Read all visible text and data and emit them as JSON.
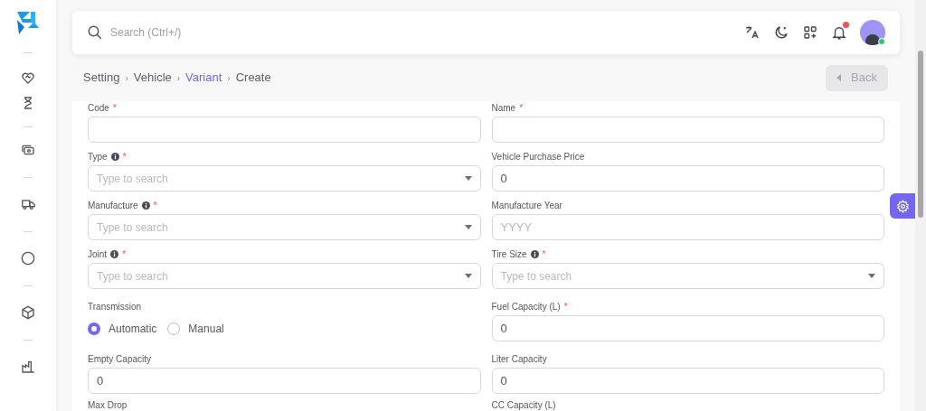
{
  "search": {
    "placeholder": "Search (Ctrl+/)"
  },
  "header": {
    "notification_unread": true,
    "user_online": true
  },
  "breadcrumb": [
    {
      "label": "Setting",
      "selected": false
    },
    {
      "separator": "›",
      "label": "Vehicle",
      "selected": false
    },
    {
      "separator": "›",
      "label": "Variant",
      "selected": true
    },
    {
      "separator": "›",
      "label": "Create",
      "selected": false
    }
  ],
  "back_button": {
    "label": "Back",
    "disabled": true
  },
  "fields": [
    {
      "kind": "text",
      "label": "Code",
      "required_mark": "*",
      "info": false
    },
    {
      "kind": "text",
      "label": "Name",
      "required_mark": "*",
      "info": false
    },
    {
      "kind": "select",
      "label": "Type",
      "required_mark": "*",
      "info": true,
      "placeholder": "Type to search"
    },
    {
      "kind": "text",
      "label": "Vehicle Purchase Price",
      "info": false,
      "value": "0"
    },
    {
      "kind": "select",
      "label": "Manufacture",
      "required_mark": "*",
      "info": true,
      "placeholder": "Type to search"
    },
    {
      "kind": "text",
      "label": "Manufacture Year",
      "info": false,
      "placeholder": "YYYY"
    },
    {
      "kind": "select",
      "label": "Joint",
      "required_mark": "*",
      "info": true,
      "placeholder": "Type to search"
    },
    {
      "kind": "select",
      "label": "Tire Size",
      "required_mark": "*",
      "info": true,
      "placeholder": "Type to search"
    },
    {
      "kind": "radio",
      "label": "Transmission",
      "info": false,
      "options": [
        {
          "label": "Automatic",
          "selected": true
        },
        {
          "label": "Manual",
          "selected": false
        }
      ]
    },
    {
      "kind": "text",
      "label": "Fuel Capacity (L)",
      "required_mark": "*",
      "info": false,
      "value": "0"
    },
    {
      "kind": "text",
      "label": "Empty Capacity",
      "info": false,
      "value": "0"
    },
    {
      "kind": "text",
      "label": "Liter Capacity",
      "info": false,
      "value": "0"
    },
    {
      "kind": "cut",
      "label": "Max Drop",
      "info": false
    },
    {
      "kind": "cut",
      "label": "CC Capacity (L)",
      "info": false
    }
  ]
}
